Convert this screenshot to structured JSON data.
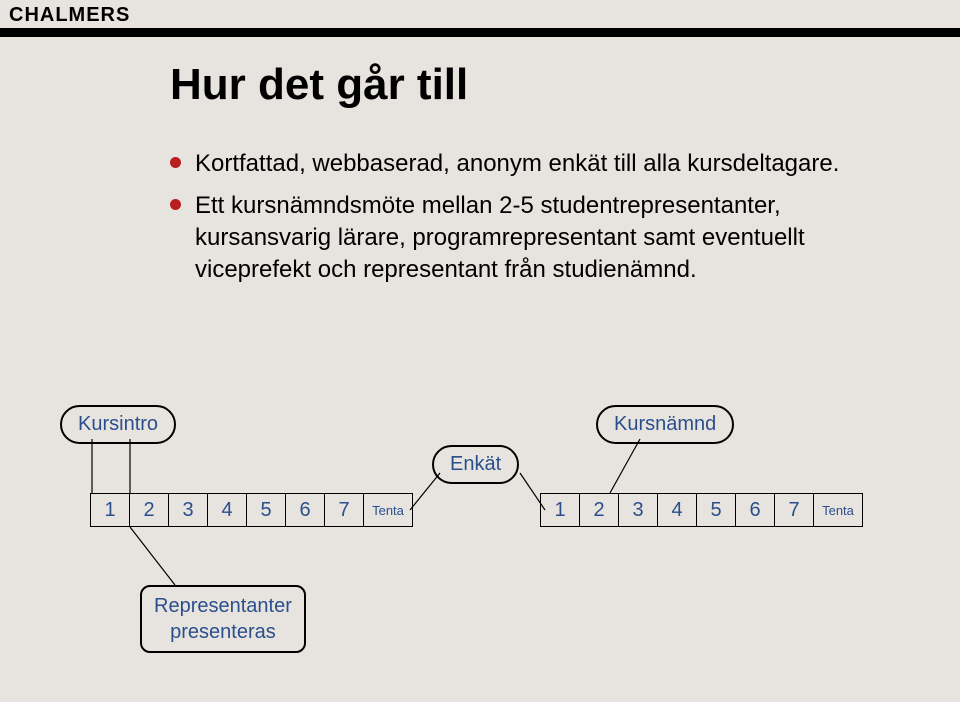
{
  "header": {
    "logo": "CHALMERS"
  },
  "title": "Hur det går till",
  "bullets": [
    "Kortfattad, webbaserad, anonym enkät till alla kursdeltagare.",
    "Ett kursnämndsmöte mellan 2-5 studentrepresentanter, kursansvarig lärare, programrepresentant samt eventuellt viceprefekt och representant från studienämnd."
  ],
  "diagram": {
    "bubbles": {
      "kursintro": "Kursintro",
      "enkat": "Enkät",
      "kursnamnd": "Kursnämnd",
      "representanter_line1": "Representanter",
      "representanter_line2": "presenteras"
    },
    "weeks1": [
      "1",
      "2",
      "3",
      "4",
      "5",
      "6",
      "7",
      "Tenta"
    ],
    "weeks2": [
      "1",
      "2",
      "3",
      "4",
      "5",
      "6",
      "7",
      "Tenta"
    ]
  }
}
